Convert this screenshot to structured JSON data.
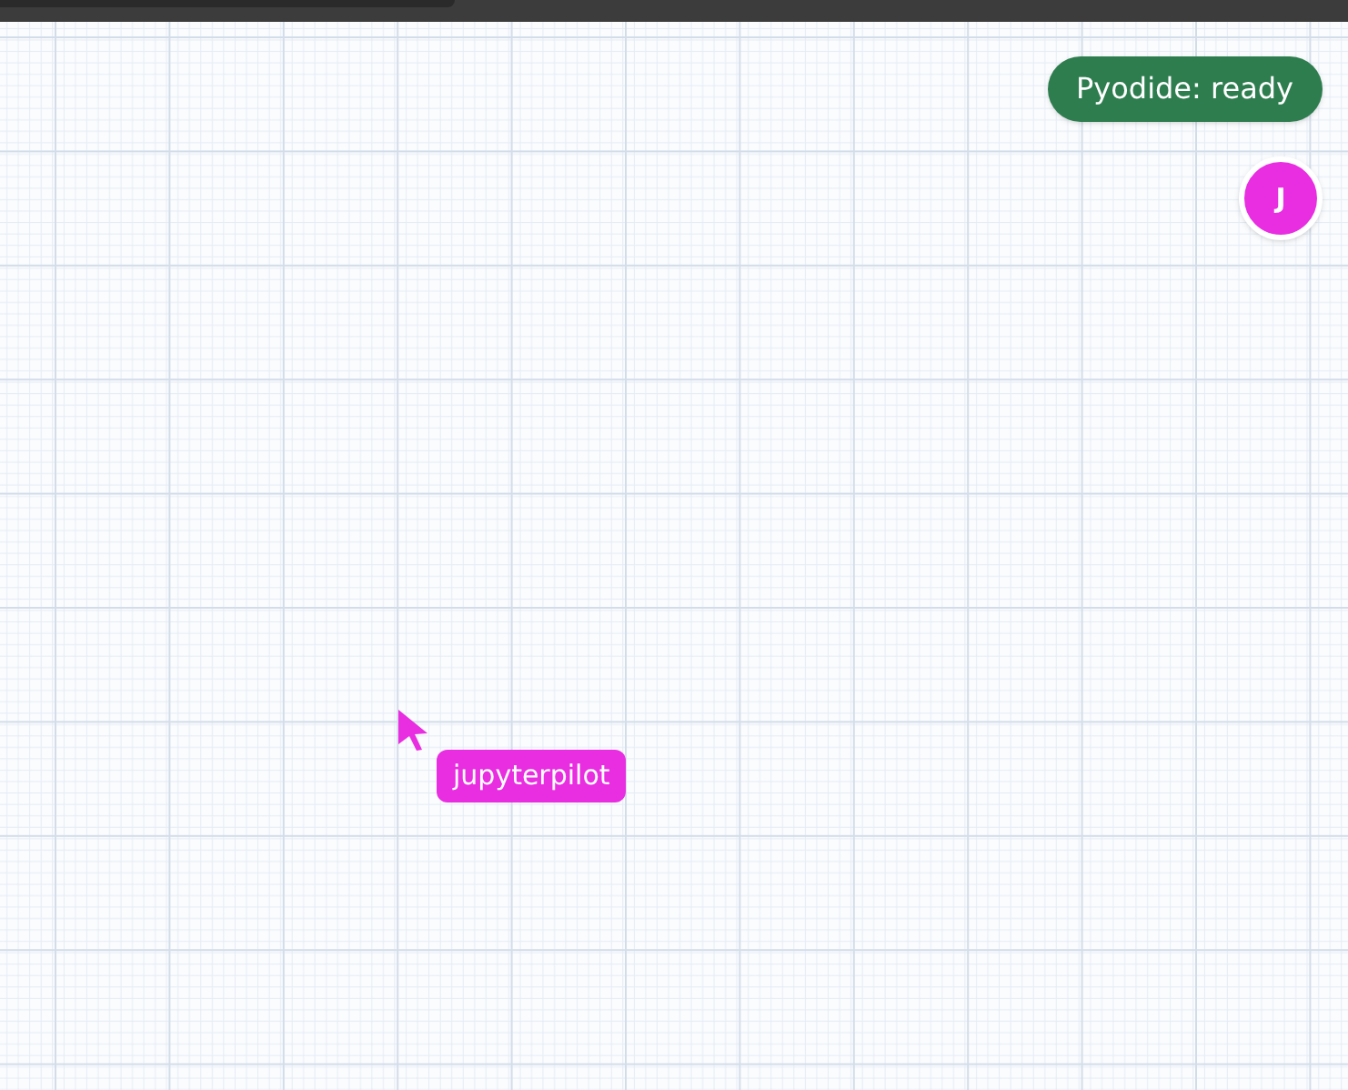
{
  "status_badge": {
    "text": "Pyodide: ready"
  },
  "user_avatar": {
    "initial": "J"
  },
  "cursors": [
    {
      "label": "jupyterpilot",
      "color": "#e82ee0"
    }
  ]
}
